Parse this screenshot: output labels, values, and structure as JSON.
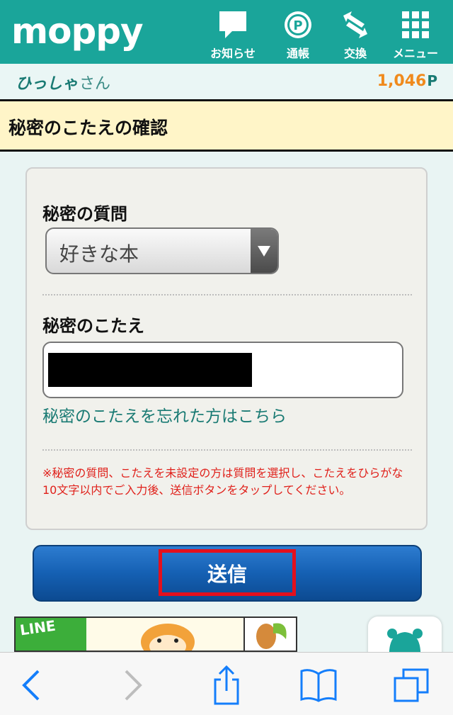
{
  "header": {
    "logo": "moppy",
    "nav": [
      {
        "label": "お知らせ",
        "icon": "notice-icon"
      },
      {
        "label": "通帳",
        "icon": "points-icon"
      },
      {
        "label": "交換",
        "icon": "exchange-icon"
      },
      {
        "label": "メニュー",
        "icon": "menu-grid-icon"
      }
    ]
  },
  "user": {
    "name": "ひっしゃ",
    "honorific": "さん",
    "points": "1,046",
    "points_unit": "P"
  },
  "page_title": "秘密のこたえの確認",
  "form": {
    "question_label": "秘密の質問",
    "question_value": "好きな本",
    "answer_label": "秘密のこたえ",
    "forgot_link": "秘密のこたえを忘れた方はこちら",
    "note": "※秘密の質問、こたえを未設定の方は質問を選択し、こたえをひらがな10文字以内でご入力後、送信ボタンをタップしてください。",
    "submit_label": "送信"
  },
  "banner": {
    "text": "LINE"
  },
  "colors": {
    "brand": "#1aa59a",
    "points": "#f08a1c",
    "note": "#e0201a",
    "submit": "#1560b3",
    "highlight": "#e3101d"
  }
}
